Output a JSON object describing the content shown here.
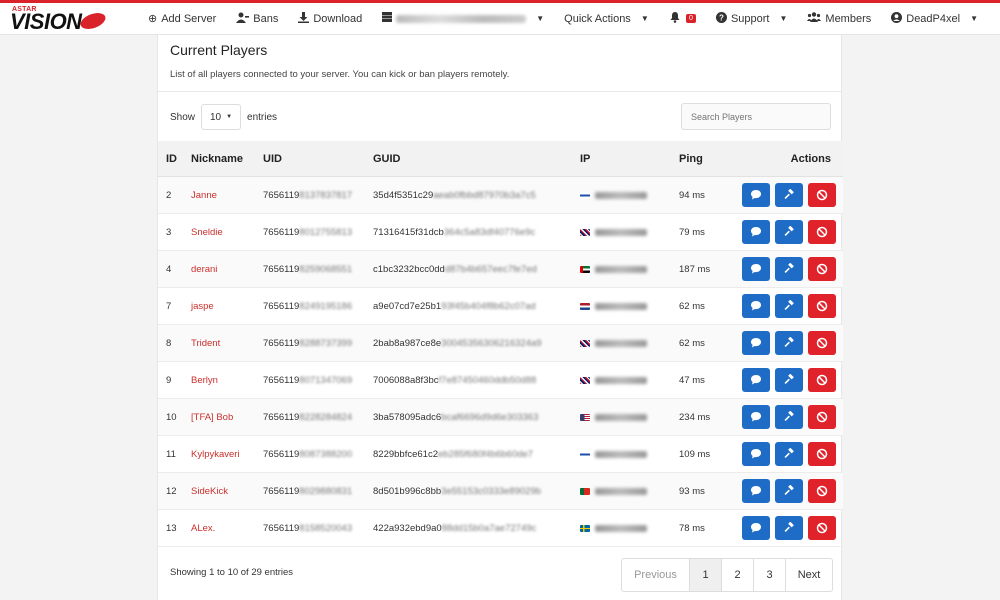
{
  "brand": {
    "small": "ASTAR",
    "big": "VISION"
  },
  "nav": {
    "add_server": "Add Server",
    "bans": "Bans",
    "download": "Download",
    "quick_actions": "Quick Actions",
    "notif_count": "0",
    "support": "Support",
    "members": "Members",
    "user": "DeadP4xel"
  },
  "card": {
    "title": "Current Players",
    "description": "List of all players connected to your server. You can kick or ban players remotely.",
    "show_label": "Show",
    "entries_value": "10",
    "entries_label": "entries",
    "search_placeholder": "Search Players"
  },
  "table": {
    "headers": {
      "id": "ID",
      "nickname": "Nickname",
      "uid": "UID",
      "guid": "GUID",
      "ip": "IP",
      "ping": "Ping",
      "actions": "Actions"
    },
    "rows": [
      {
        "id": "2",
        "nick": "Janne",
        "uid_a": "7656119",
        "uid_b": "8137837817",
        "guid_a": "35d4f5351c29",
        "guid_b": "aeab0fbbd87970b3a7c5",
        "flag": "fi",
        "ping": "94 ms"
      },
      {
        "id": "3",
        "nick": "Sneldie",
        "uid_a": "7656119",
        "uid_b": "8012755813",
        "guid_a": "71316415f31dcb",
        "guid_b": "364c5a83df40776e9c",
        "flag": "gb",
        "ping": "79 ms"
      },
      {
        "id": "4",
        "nick": "derani",
        "uid_a": "7656119",
        "uid_b": "8259068551",
        "guid_a": "c1bc3232bcc0dd",
        "guid_b": "d87b4b657eec7fe7ed",
        "flag": "ae",
        "ping": "187 ms"
      },
      {
        "id": "7",
        "nick": "jaspe",
        "uid_a": "7656119",
        "uid_b": "8249195186",
        "guid_a": "a9e07cd7e25b1",
        "guid_b": "93f45b404f8b62c07ad",
        "flag": "nl",
        "ping": "62 ms"
      },
      {
        "id": "8",
        "nick": "Trident",
        "uid_a": "7656119",
        "uid_b": "8288737399",
        "guid_a": "2bab8a987ce8e",
        "guid_b": "30045356306216324a9",
        "flag": "gb",
        "ping": "62 ms"
      },
      {
        "id": "9",
        "nick": "Berlyn",
        "uid_a": "7656119",
        "uid_b": "8071347069",
        "guid_a": "7006088a8f3bc",
        "guid_b": "f7e87450460ddb50d88",
        "flag": "gb",
        "ping": "47 ms"
      },
      {
        "id": "10",
        "nick": "[TFA] Bob",
        "uid_a": "7656119",
        "uid_b": "8228284824",
        "guid_a": "3ba578095adc6",
        "guid_b": "bcaf6696d9d6e303363",
        "flag": "us",
        "ping": "234 ms"
      },
      {
        "id": "11",
        "nick": "Kylpykaveri",
        "uid_a": "7656119",
        "uid_b": "8087388200",
        "guid_a": "8229bbfce61c2",
        "guid_b": "eb285f680f4b6b60de7",
        "flag": "fi",
        "ping": "109 ms"
      },
      {
        "id": "12",
        "nick": "SideKick",
        "uid_a": "7656119",
        "uid_b": "8029880831",
        "guid_a": "8d501b996c8bb",
        "guid_b": "3e55153c0333e89029b",
        "flag": "pt",
        "ping": "93 ms"
      },
      {
        "id": "13",
        "nick": "ALex.",
        "uid_a": "7656119",
        "uid_b": "8158520043",
        "guid_a": "422a932ebd9a0",
        "guid_b": "88dd15b0a7ae72749c",
        "flag": "se",
        "ping": "78 ms"
      }
    ]
  },
  "footer": {
    "info": "Showing 1 to 10 of 29 entries",
    "prev": "Previous",
    "pages": [
      "1",
      "2",
      "3"
    ],
    "active_page": "1",
    "next": "Next"
  },
  "colors": {
    "accent": "#d9222a",
    "primary": "#1f6cc7",
    "danger": "#e0232b",
    "link": "#c9302c"
  },
  "icons": {
    "message": "message-icon",
    "kick": "hammer-icon",
    "ban": "ban-icon"
  }
}
